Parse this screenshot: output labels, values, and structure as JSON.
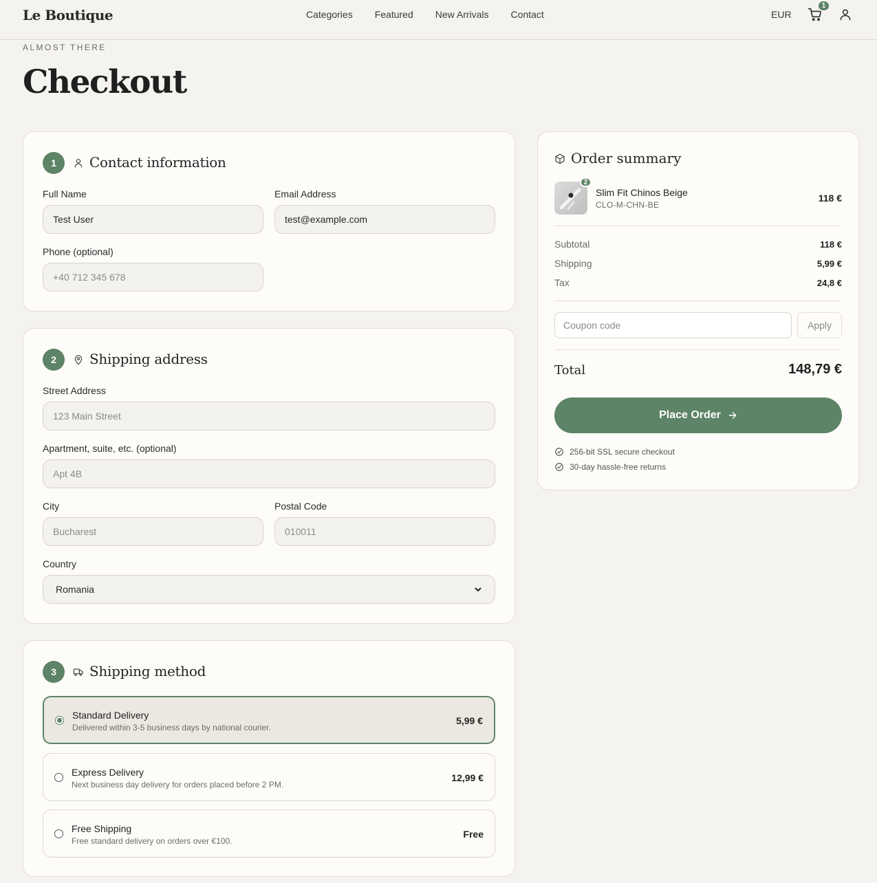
{
  "header": {
    "brand": "Le Boutique",
    "nav": [
      "Categories",
      "Featured",
      "New Arrivals",
      "Contact"
    ],
    "currency": "EUR",
    "cart_count": "1"
  },
  "page": {
    "eyebrow": "ALMOST THERE",
    "title": "Checkout"
  },
  "contact": {
    "step": "1",
    "title": "Contact information",
    "full_name_label": "Full Name",
    "full_name_value": "Test User",
    "email_label": "Email Address",
    "email_value": "test@example.com",
    "phone_label": "Phone (optional)",
    "phone_placeholder": "+40 712 345 678"
  },
  "shipping_address": {
    "step": "2",
    "title": "Shipping address",
    "street_label": "Street Address",
    "street_placeholder": "123 Main Street",
    "apt_label": "Apartment, suite, etc. (optional)",
    "apt_placeholder": "Apt 4B",
    "city_label": "City",
    "city_placeholder": "Bucharest",
    "postal_label": "Postal Code",
    "postal_placeholder": "010011",
    "country_label": "Country",
    "country_value": "Romania"
  },
  "shipping_method": {
    "step": "3",
    "title": "Shipping method",
    "options": [
      {
        "title": "Standard Delivery",
        "desc": "Delivered within 3-5 business days by national courier.",
        "price": "5,99 €",
        "selected": true
      },
      {
        "title": "Express Delivery",
        "desc": "Next business day delivery for orders placed before 2 PM.",
        "price": "12,99 €",
        "selected": false
      },
      {
        "title": "Free Shipping",
        "desc": "Free standard delivery on orders over €100.",
        "price": "Free",
        "selected": false
      }
    ]
  },
  "summary": {
    "title": "Order summary",
    "item": {
      "name": "Slim Fit Chinos Beige",
      "sku": "CLO-M-CHN-BE",
      "price": "118 €",
      "qty": "2"
    },
    "subtotal_label": "Subtotal",
    "subtotal": "118 €",
    "shipping_label": "Shipping",
    "shipping": "5,99 €",
    "tax_label": "Tax",
    "tax": "24,8 €",
    "coupon_placeholder": "Coupon code",
    "apply_label": "Apply",
    "total_label": "Total",
    "total": "148,79 €",
    "place_order_label": "Place Order",
    "trust": [
      "256-bit SSL secure checkout",
      "30-day hassle-free returns"
    ]
  },
  "colors": {
    "accent": "#5d8466",
    "background": "#f5f3ef",
    "card": "#fdfcf9"
  }
}
